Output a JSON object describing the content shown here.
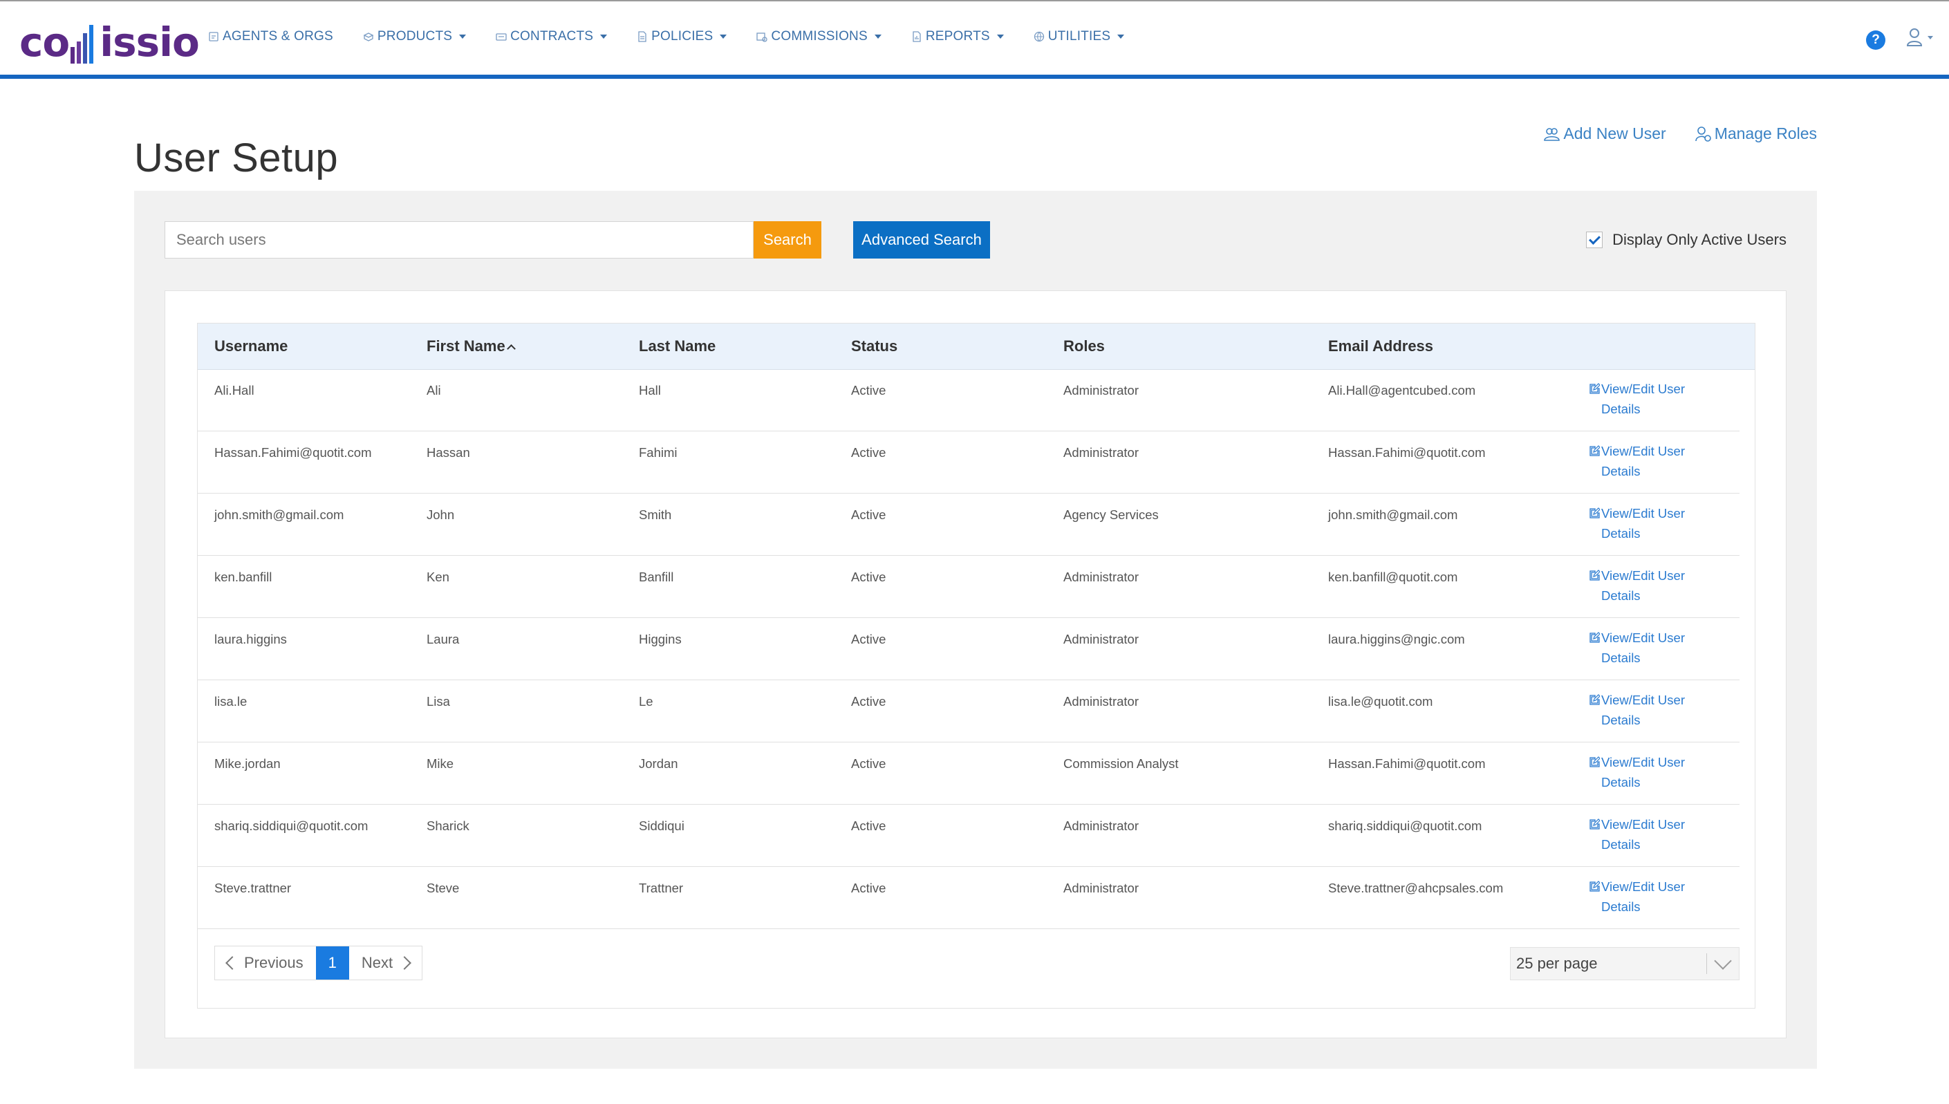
{
  "app": {
    "logo_text_left": "co",
    "logo_text_right": "issio",
    "nav": [
      {
        "label": "AGENTS & ORGS",
        "icon": "agents-icon",
        "has_caret": false
      },
      {
        "label": "PRODUCTS",
        "icon": "products-icon",
        "has_caret": true
      },
      {
        "label": "CONTRACTS",
        "icon": "contracts-icon",
        "has_caret": true
      },
      {
        "label": "POLICIES",
        "icon": "policies-icon",
        "has_caret": true
      },
      {
        "label": "COMMISSIONS",
        "icon": "commissions-icon",
        "has_caret": true
      },
      {
        "label": "REPORTS",
        "icon": "reports-icon",
        "has_caret": true
      },
      {
        "label": "UTILITIES",
        "icon": "utilities-icon",
        "has_caret": true
      }
    ],
    "help_label": "?",
    "accent_color": "#1565c0",
    "brand_color": "#5b2a86"
  },
  "page": {
    "title": "User Setup",
    "add_user_label": "Add New User",
    "manage_roles_label": "Manage Roles"
  },
  "search": {
    "placeholder": "Search users",
    "value": "",
    "search_label": "Search",
    "advanced_label": "Advanced Search",
    "active_only_label": "Display Only Active Users",
    "active_only_checked": true
  },
  "table": {
    "headers": {
      "username": "Username",
      "first_name": "First Name",
      "last_name": "Last Name",
      "status": "Status",
      "roles": "Roles",
      "email": "Email Address"
    },
    "action_label_line1": "View/Edit User",
    "action_label_line2": "Details",
    "rows": [
      {
        "username": "Ali.Hall",
        "first": "Ali",
        "last": "Hall",
        "status": "Active",
        "roles": "Administrator",
        "email": "Ali.Hall@agentcubed.com"
      },
      {
        "username": "Hassan.Fahimi@quotit.com",
        "first": "Hassan",
        "last": "Fahimi",
        "status": "Active",
        "roles": "Administrator",
        "email": "Hassan.Fahimi@quotit.com"
      },
      {
        "username": "john.smith@gmail.com",
        "first": "John",
        "last": "Smith",
        "status": "Active",
        "roles": "Agency Services",
        "email": "john.smith@gmail.com"
      },
      {
        "username": "ken.banfill",
        "first": "Ken",
        "last": "Banfill",
        "status": "Active",
        "roles": "Administrator",
        "email": "ken.banfill@quotit.com"
      },
      {
        "username": "laura.higgins",
        "first": "Laura",
        "last": "Higgins",
        "status": "Active",
        "roles": "Administrator",
        "email": "laura.higgins@ngic.com"
      },
      {
        "username": "lisa.le",
        "first": "Lisa",
        "last": "Le",
        "status": "Active",
        "roles": "Administrator",
        "email": "lisa.le@quotit.com"
      },
      {
        "username": "Mike.jordan",
        "first": "Mike",
        "last": "Jordan",
        "status": "Active",
        "roles": "Commission Analyst",
        "email": "Hassan.Fahimi@quotit.com"
      },
      {
        "username": "shariq.siddiqui@quotit.com",
        "first": "Sharick",
        "last": "Siddiqui",
        "status": "Active",
        "roles": "Administrator",
        "email": "shariq.siddiqui@quotit.com"
      },
      {
        "username": "Steve.trattner",
        "first": "Steve",
        "last": "Trattner",
        "status": "Active",
        "roles": "Administrator",
        "email": "Steve.trattner@ahcpsales.com"
      }
    ]
  },
  "pagination": {
    "previous_label": "Previous",
    "current_page": "1",
    "next_label": "Next",
    "per_page_label": "25 per page"
  }
}
